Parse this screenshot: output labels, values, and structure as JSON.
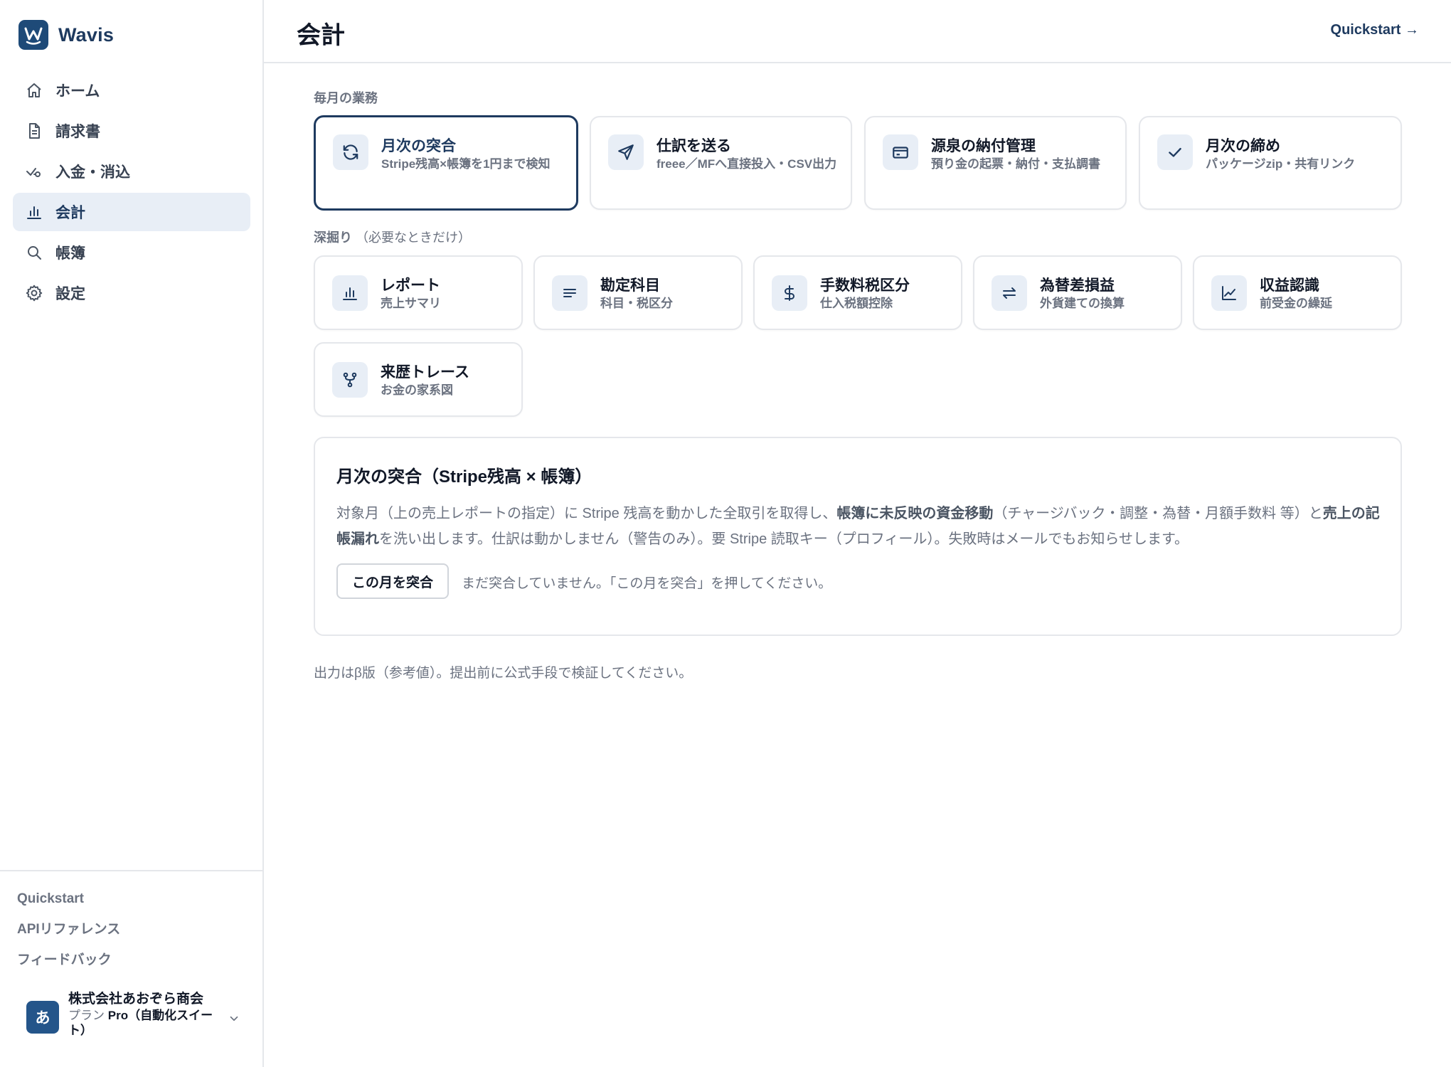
{
  "brand": {
    "name": "Wavis"
  },
  "sidebar": {
    "items": [
      {
        "label": "ホーム",
        "icon": "home-icon"
      },
      {
        "label": "請求書",
        "icon": "document-icon"
      },
      {
        "label": "入金・消込",
        "icon": "check-link-icon"
      },
      {
        "label": "会計",
        "icon": "bar-chart-icon",
        "active": true
      },
      {
        "label": "帳簿",
        "icon": "search-icon"
      },
      {
        "label": "設定",
        "icon": "gear-icon"
      }
    ],
    "footer_links": [
      "Quickstart",
      "APIリファレンス",
      "フィードバック"
    ],
    "account": {
      "avatar": "あ",
      "name": "株式会社あおぞら商会",
      "plan_prefix": "プラン",
      "plan_name": "Pro（自動化スイート）"
    }
  },
  "header": {
    "title": "会計",
    "quickstart_label": "Quickstart →"
  },
  "monthly": {
    "label": "毎月の業務",
    "cards": [
      {
        "title": "月次の突合",
        "sub": "Stripe残高×帳簿を1円まで検知",
        "icon": "refresh-icon",
        "selected": true
      },
      {
        "title": "仕訳を送る",
        "sub": "freee／MFへ直接投入・CSV出力",
        "icon": "send-icon"
      },
      {
        "title": "源泉の納付管理",
        "sub": "預り金の起票・納付・支払調書",
        "icon": "card-icon"
      },
      {
        "title": "月次の締め",
        "sub": "パッケージzip・共有リンク",
        "icon": "check-icon"
      }
    ]
  },
  "deep": {
    "label": "深掘り",
    "label_note": "（必要なときだけ）",
    "cards": [
      {
        "title": "レポート",
        "sub": "売上サマリ",
        "icon": "bar-chart-icon"
      },
      {
        "title": "勘定科目",
        "sub": "科目・税区分",
        "icon": "list-icon"
      },
      {
        "title": "手数料税区分",
        "sub": "仕入税額控除",
        "icon": "dollar-icon"
      },
      {
        "title": "為替差損益",
        "sub": "外貨建ての換算",
        "icon": "exchange-icon"
      },
      {
        "title": "収益認識",
        "sub": "前受金の繰延",
        "icon": "line-chart-icon"
      },
      {
        "title": "来歴トレース",
        "sub": "お金の家系図",
        "icon": "branch-icon"
      }
    ]
  },
  "panel": {
    "title": "月次の突合（Stripe残高 × 帳簿）",
    "desc_1": "対象月（上の売上レポートの指定）に Stripe 残高を動かした全取引を取得し、",
    "desc_bold_1": "帳簿に未反映の資金移動",
    "desc_2": "（チャージバック・調整・為替・月額手数料 等）と",
    "desc_bold_2": "売上の記帳漏れ",
    "desc_3": "を洗い出します。仕訳は動かしません（警告のみ）。要 Stripe 読取キー（プロフィール）。失敗時はメールでもお知らせします。",
    "button_label": "この月を突合",
    "status": "まだ突合していません。「この月を突合」を押してください。"
  },
  "footer_note": "出力はβ版（参考値）。提出前に公式手段で検証してください。"
}
